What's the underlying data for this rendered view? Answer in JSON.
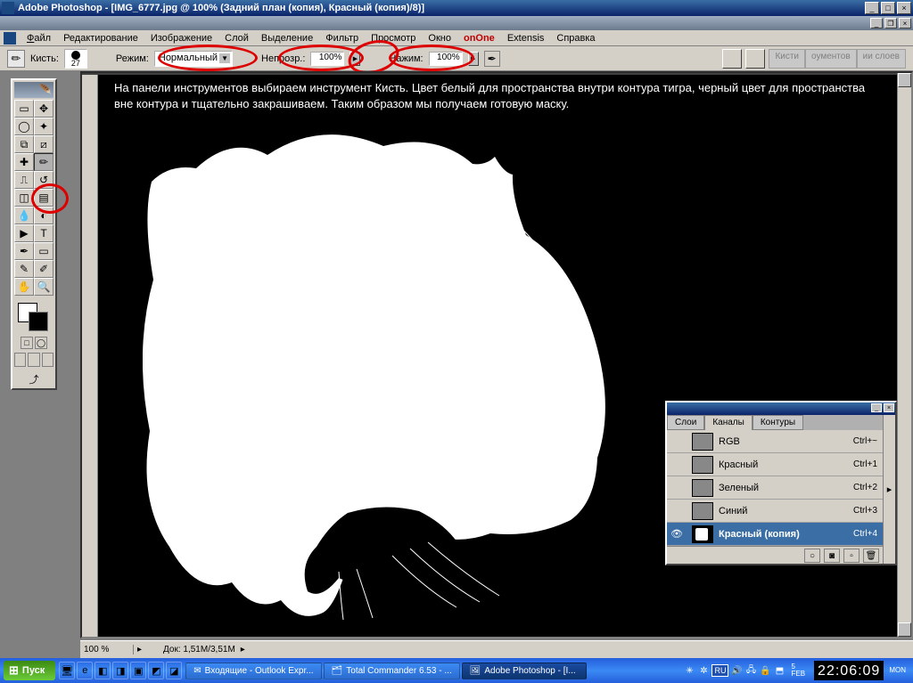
{
  "app": {
    "title": "Adobe Photoshop - [IMG_6777.jpg @ 100% (Задний план (копия), Красный (копия)/8)]"
  },
  "menu": {
    "file": "Файл",
    "edit": "Редактирование",
    "image": "Изображение",
    "layer": "Слой",
    "select": "Выделение",
    "filter": "Фильтр",
    "view": "Просмотр",
    "window": "Окно",
    "onone": "onOne",
    "extensis": "Extensis",
    "help": "Справка"
  },
  "opt": {
    "brush_label": "Кисть:",
    "brush_size": "27",
    "mode_label": "Режим:",
    "mode_value": "Нормальный",
    "opacity_label": "Непрозр.:",
    "opacity_value": "100%",
    "flow_label": "Нажим:",
    "flow_value": "100%"
  },
  "palette_tabs": {
    "brushes": "Кисти",
    "tool_presets": "оументов",
    "layer_comps": "ии слоев"
  },
  "instruction": "На панели инструментов выбираем инструмент Кисть. Цвет белый для пространства внутри контура тигра, черный цвет для пространства вне контура и тщательно закрашиваем. Таким образом мы получаем готовую маску.",
  "status": {
    "zoom": "100 %",
    "doc": "Док: 1,51M/3,51M"
  },
  "channels": {
    "tabs": {
      "layers": "Слои",
      "channels": "Каналы",
      "paths": "Контуры"
    },
    "rows": [
      {
        "name": "RGB",
        "short": "Ctrl+~"
      },
      {
        "name": "Красный",
        "short": "Ctrl+1"
      },
      {
        "name": "Зеленый",
        "short": "Ctrl+2"
      },
      {
        "name": "Синий",
        "short": "Ctrl+3"
      },
      {
        "name": "Красный (копия)",
        "short": "Ctrl+4"
      }
    ]
  },
  "taskbar": {
    "start": "Пуск",
    "tasks": [
      {
        "label": "Входящие - Outlook Expr..."
      },
      {
        "label": "Total Commander 6.53 - ..."
      },
      {
        "label": "Adobe Photoshop - [I..."
      }
    ],
    "lang": "RU",
    "time": "22:06:09",
    "day": "MON",
    "date_top": "5",
    "date_bot": "FEB"
  }
}
